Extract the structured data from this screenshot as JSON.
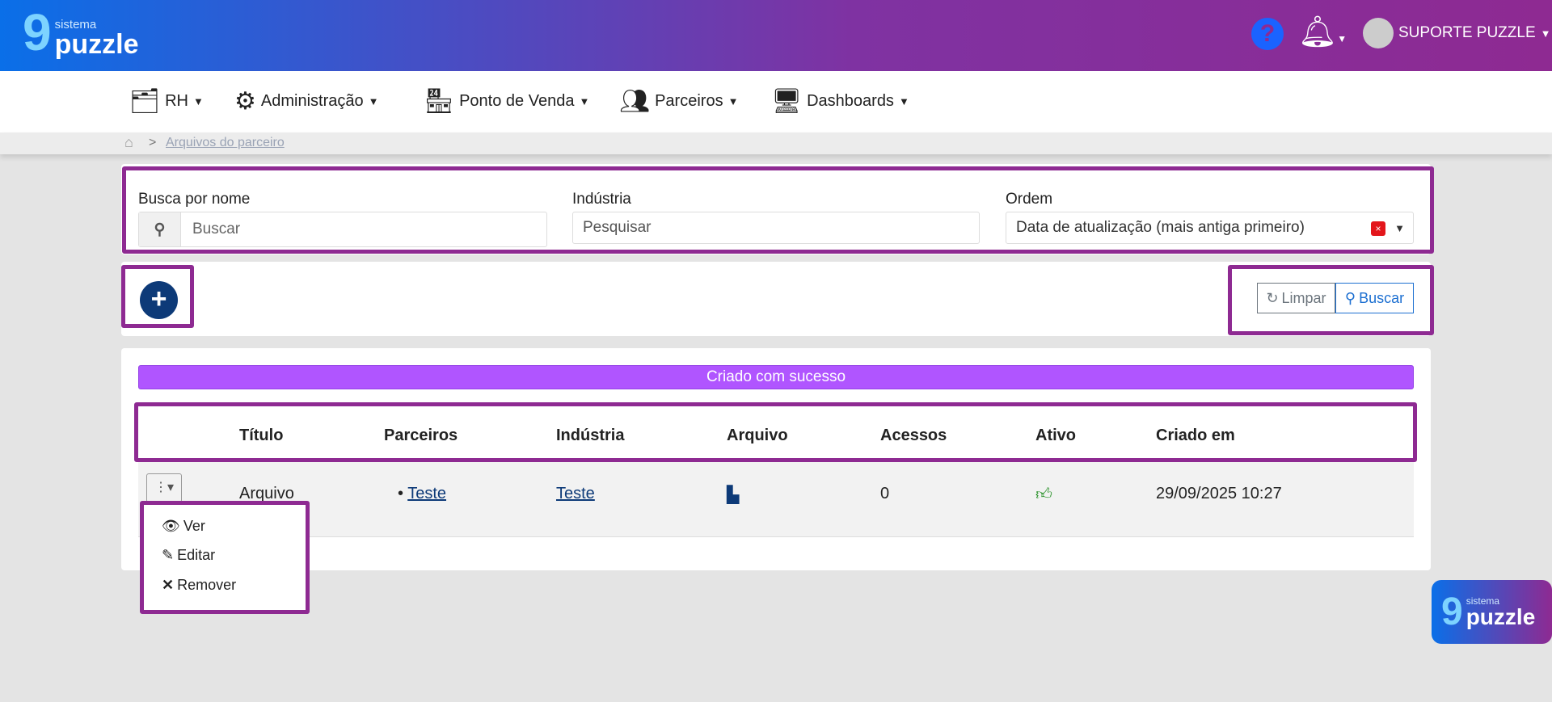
{
  "header": {
    "logo_small": "sistema",
    "logo_big": "puzzle",
    "user": "SUPORTE PUZZLE"
  },
  "nav": [
    {
      "label": "RH",
      "icon": "id-card-icon"
    },
    {
      "label": "Administração",
      "icon": "gears-icon"
    },
    {
      "label": "Ponto de Venda",
      "icon": "store-icon"
    },
    {
      "label": "Parceiros",
      "icon": "people-icon"
    },
    {
      "label": "Dashboards",
      "icon": "monitor-chart-icon"
    }
  ],
  "breadcrumb": {
    "sep": ">",
    "current": "Arquivos do parceiro"
  },
  "filters": {
    "name_label": "Busca por nome",
    "name_placeholder": "Buscar",
    "industry_label": "Indústria",
    "industry_placeholder": "Pesquisar",
    "order_label": "Ordem",
    "order_value": "Data de atualização (mais antiga primeiro)"
  },
  "actions": {
    "clear": "Limpar",
    "search": "Buscar"
  },
  "alert": "Criado com sucesso",
  "table": {
    "headers": [
      "Título",
      "Parceiros",
      "Indústria",
      "Arquivo",
      "Acessos",
      "Ativo",
      "Criado em"
    ],
    "rows": [
      {
        "titulo": "Arquivo",
        "parceiro": "Teste",
        "industria": "Teste",
        "acessos": "0",
        "criado": "29/09/2025 10:27"
      }
    ]
  },
  "menu": {
    "ver": "Ver",
    "editar": "Editar",
    "remover": "Remover"
  },
  "colors": {
    "accent": "#8e2a92",
    "alert": "#b055ff",
    "primary": "#0d3a78"
  }
}
